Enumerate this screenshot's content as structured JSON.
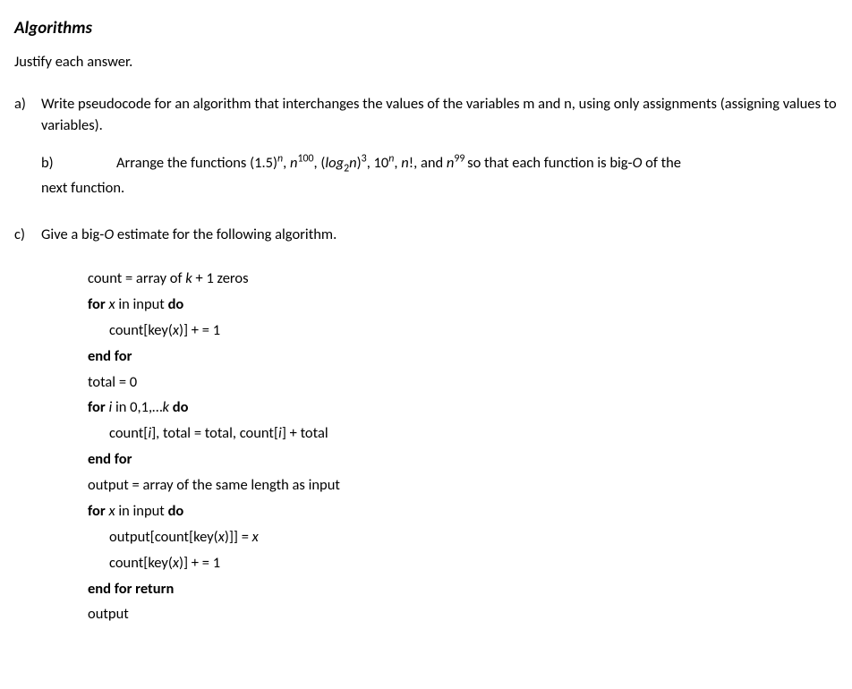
{
  "title": "Algorithms",
  "intro": "Justify each answer.",
  "qa": {
    "label": "a)",
    "text": "Write pseudocode for an algorithm that interchanges the values of the variables m and n, using only assignments (assigning values to variables)."
  },
  "qb": {
    "label": "b)",
    "pre": "Arrange the functions (1.5)",
    "f1_sup": "n",
    "c1": ", ",
    "f2_base": "n",
    "f2_sup": "100",
    "c2": ", (",
    "f3_log": "log",
    "f3_sub": "2",
    "f3_n": "n",
    "f3_close": ")",
    "f3_sup": "3",
    "c3": ", 10",
    "f4_sup": "n",
    "c4": ", ",
    "f5": "n",
    "f5_excl": "!, and ",
    "f6_base": "n",
    "f6_sup": "99 ",
    "tail": "so that each function is big-",
    "bigO": "O ",
    "tail2": "of the",
    "line2": "next function."
  },
  "qc": {
    "label": "c)",
    "pre": "Give a big-",
    "bigO": "O",
    "post": " estimate for the following algorithm."
  },
  "code": {
    "l1a": "count = array of ",
    "l1k": "k",
    "l1b": " + 1 zeros",
    "l2a": "for ",
    "l2x": "x",
    "l2b": " in input ",
    "l2do": "do",
    "l3a": "count[key(",
    "l3x": "x",
    "l3b": ")] + = 1",
    "l4": "end for",
    "l5": "total = 0",
    "l6a": "for ",
    "l6i": "i",
    "l6b": " in 0,1,…",
    "l6k": "k ",
    "l6do": "do",
    "l7a": "count[",
    "l7i1": "i",
    "l7b": "], total = total, count[",
    "l7i2": "i",
    "l7c": "] + total",
    "l8": "end for",
    "l9": "output = array of the same length as input",
    "l10a": "for ",
    "l10x": "x",
    "l10b": " in input ",
    "l10do": "do",
    "l11a": "output[count[key(",
    "l11x": "x",
    "l11b": ")]] = ",
    "l11x2": "x",
    "l12a": "count[key(",
    "l12x": "x",
    "l12b": ")] + = 1",
    "l13": "end for return",
    "l14": "output"
  }
}
